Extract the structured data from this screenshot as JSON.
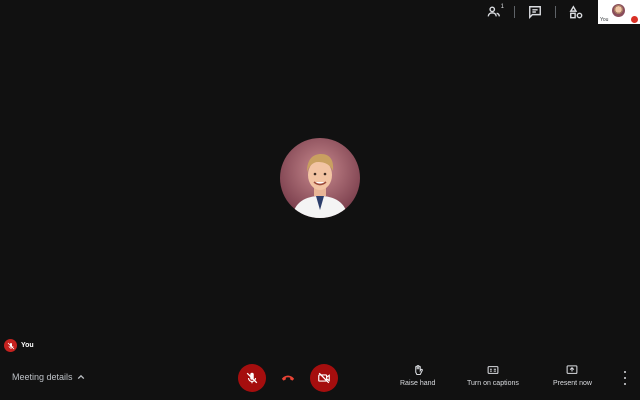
{
  "topbar": {
    "people_count": "1"
  },
  "self_view": {
    "label": "You"
  },
  "participant": {
    "name": "You"
  },
  "bottom": {
    "meeting_details_label": "Meeting details",
    "raise_hand_label": "Raise hand",
    "captions_label": "Turn on captions",
    "present_label": "Present now"
  },
  "colors": {
    "background": "#111111",
    "danger": "#a50e0e",
    "hangup": "#ea4335"
  }
}
